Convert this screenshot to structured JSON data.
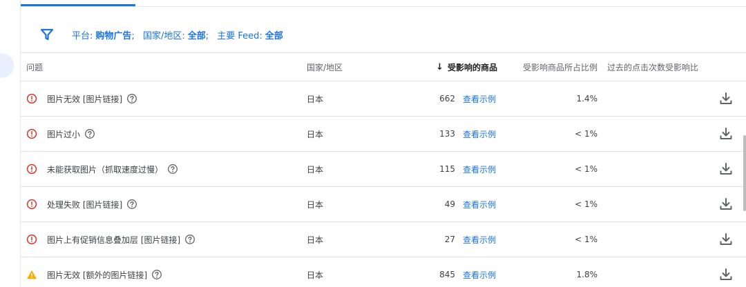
{
  "filter": {
    "icon": "filter-icon",
    "platform_label": "平台:",
    "platform_value": "购物广告",
    "country_label": "国家/地区:",
    "country_value": "全部",
    "feed_label": "主要 Feed:",
    "feed_value": "全部",
    "separator": ";"
  },
  "table": {
    "headers": {
      "issue": "问题",
      "country": "国家/地区",
      "affected_sort_arrow": "↓",
      "affected": "受影响的商品",
      "ratio": "受影响商品所占比例",
      "clicks": "过去的点击次数受影响比"
    },
    "rows": [
      {
        "status": "error",
        "issue": "图片无效 [图片链接]",
        "country": "日本",
        "count": "662",
        "link": "查看示例",
        "ratio": "1.4%"
      },
      {
        "status": "error",
        "issue": "图片过小",
        "country": "日本",
        "count": "133",
        "link": "查看示例",
        "ratio": "< 1%"
      },
      {
        "status": "error",
        "issue": "未能获取图片（抓取速度过慢）",
        "country": "日本",
        "count": "115",
        "link": "查看示例",
        "ratio": "< 1%"
      },
      {
        "status": "error",
        "issue": "处理失败 [图片链接]",
        "country": "日本",
        "count": "49",
        "link": "查看示例",
        "ratio": "< 1%"
      },
      {
        "status": "error",
        "issue": "图片上有促销信息叠加层 [图片链接]",
        "country": "日本",
        "count": "27",
        "link": "查看示例",
        "ratio": "< 1%"
      },
      {
        "status": "warning",
        "issue": "图片无效 [额外的图片链接]",
        "country": "日本",
        "count": "845",
        "link": "查看示例",
        "ratio": "1.8%"
      }
    ]
  },
  "colors": {
    "accent": "#1a73e8",
    "error": "#d93025",
    "warning": "#f9ab00"
  }
}
